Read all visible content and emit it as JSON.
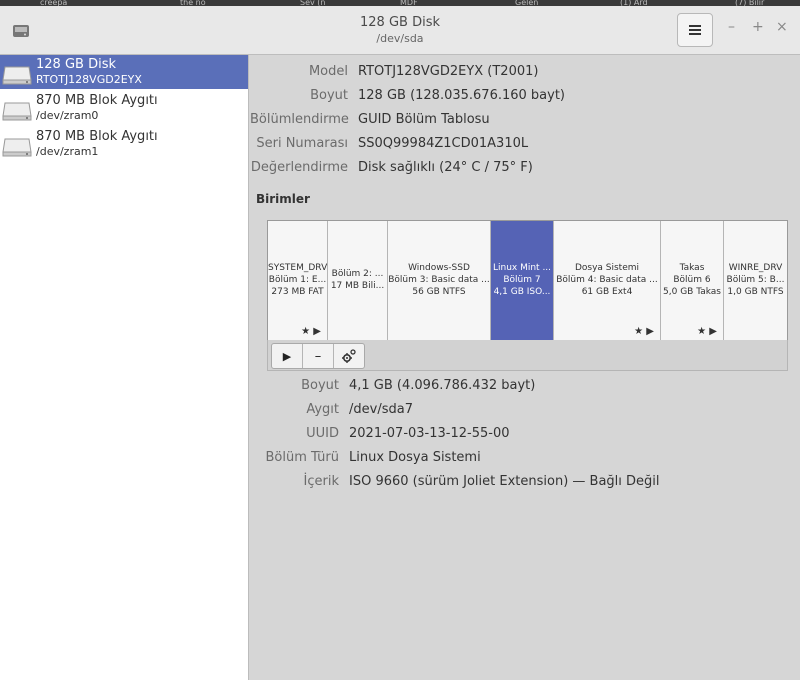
{
  "window": {
    "title": "128 GB Disk",
    "subtitle": "/dev/sda",
    "menu_icon": "hamburger-icon",
    "controls": [
      "–",
      "+",
      "×"
    ]
  },
  "tabs": [
    "creepa",
    "the no",
    "Sev (n",
    "MDF",
    "Gelen",
    "(1) Ard",
    "(7) Bilir"
  ],
  "sidebar": {
    "devices": [
      {
        "name": "128 GB Disk",
        "path": "RTOTJ128VGD2EYX",
        "icon": "hard-disk-icon"
      },
      {
        "name": "870 MB Blok Aygıtı",
        "path": "/dev/zram0",
        "icon": "hard-disk-icon"
      },
      {
        "name": "870 MB Blok Aygıtı",
        "path": "/dev/zram1",
        "icon": "hard-disk-icon"
      }
    ]
  },
  "disk_info": [
    {
      "label": "Model",
      "value": "RTOTJ128VGD2EYX (T2001)"
    },
    {
      "label": "Boyut",
      "value": "128 GB (128.035.676.160 bayt)"
    },
    {
      "label": "Bölümlendirme",
      "value": "GUID Bölüm Tablosu"
    },
    {
      "label": "Seri Numarası",
      "value": "SS0Q99984Z1CD01A310L"
    },
    {
      "label": "Değerlendirme",
      "value": "Disk sağlıklı (24° C / 75° F)"
    }
  ],
  "volumes_label": "Birimler",
  "volumes": [
    {
      "l1": "SYSTEM_DRV",
      "l2": "Bölüm 1: E...",
      "l3": "273 MB FAT",
      "marks": "★ ▶"
    },
    {
      "l1": "",
      "l2": "Bölüm 2: ...",
      "l3": "17 MB Bili...",
      "marks": ""
    },
    {
      "l1": "Windows-SSD",
      "l2": "Bölüm 3: Basic data ...",
      "l3": "56 GB NTFS",
      "marks": ""
    },
    {
      "l1": "Linux Mint ...",
      "l2": "Bölüm 7",
      "l3": "4,1 GB ISO...",
      "marks": ""
    },
    {
      "l1": "Dosya Sistemi",
      "l2": "Bölüm 4: Basic data ...",
      "l3": "61 GB Ext4",
      "marks": "★ ▶"
    },
    {
      "l1": "Takas",
      "l2": "Bölüm 6",
      "l3": "5,0 GB Takas",
      "marks": "★ ▶"
    },
    {
      "l1": "WINRE_DRV",
      "l2": "Bölüm 5: B...",
      "l3": "1,0 GB NTFS",
      "marks": ""
    }
  ],
  "toolbar": {
    "play": "▶",
    "minus": "–",
    "gear_icon": "gears-icon"
  },
  "partition_info": [
    {
      "label": "Boyut",
      "value": "4,1 GB (4.096.786.432 bayt)"
    },
    {
      "label": "Aygıt",
      "value": "/dev/sda7"
    },
    {
      "label": "UUID",
      "value": "2021-07-03-13-12-55-00"
    },
    {
      "label": "Bölüm Türü",
      "value": "Linux Dosya Sistemi"
    },
    {
      "label": "İçerik",
      "value": "ISO 9660 (sürüm Joliet Extension) — Bağlı Değil"
    }
  ]
}
